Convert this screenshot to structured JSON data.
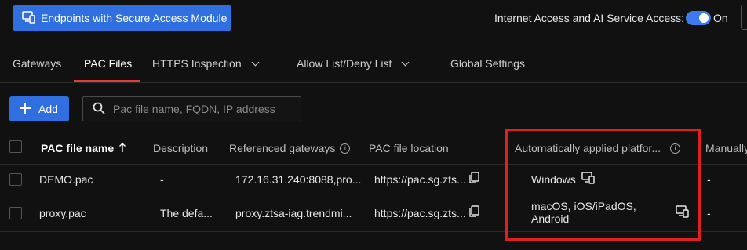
{
  "topbar": {
    "endpoints_button": "Endpoints with Secure Access Module",
    "access_label": "Internet Access and AI Service Access:",
    "toggle_state": "On"
  },
  "tabs": [
    {
      "label": "Gateways"
    },
    {
      "label": "PAC Files"
    },
    {
      "label": "HTTPS Inspection"
    },
    {
      "label": "Allow List/Deny List"
    },
    {
      "label": "Global Settings"
    }
  ],
  "toolbar": {
    "add_label": "Add",
    "search_placeholder": "Pac file name, FQDN, IP address"
  },
  "table": {
    "columns": {
      "name": "PAC file name",
      "description": "Description",
      "gateways": "Referenced gateways",
      "location": "PAC file location",
      "platforms": "Automatically applied platfor...",
      "manual": "Manually"
    },
    "rows": [
      {
        "name": "DEMO.pac",
        "description": "-",
        "gateways": "172.16.31.240:8088,pro...",
        "location": "https://pac.sg.zts...",
        "platforms": "Windows",
        "manual": "-"
      },
      {
        "name": "proxy.pac",
        "description": "The defa...",
        "gateways": "proxy.ztsa-iag.trendmi...",
        "location": "https://pac.sg.zts...",
        "platforms": "macOS, iOS/iPadOS, Android",
        "manual": "-"
      }
    ]
  },
  "colors": {
    "accent": "#2f6fe0",
    "tab_indicator": "#e23b3b",
    "highlight": "#e02020",
    "background": "#111111"
  }
}
